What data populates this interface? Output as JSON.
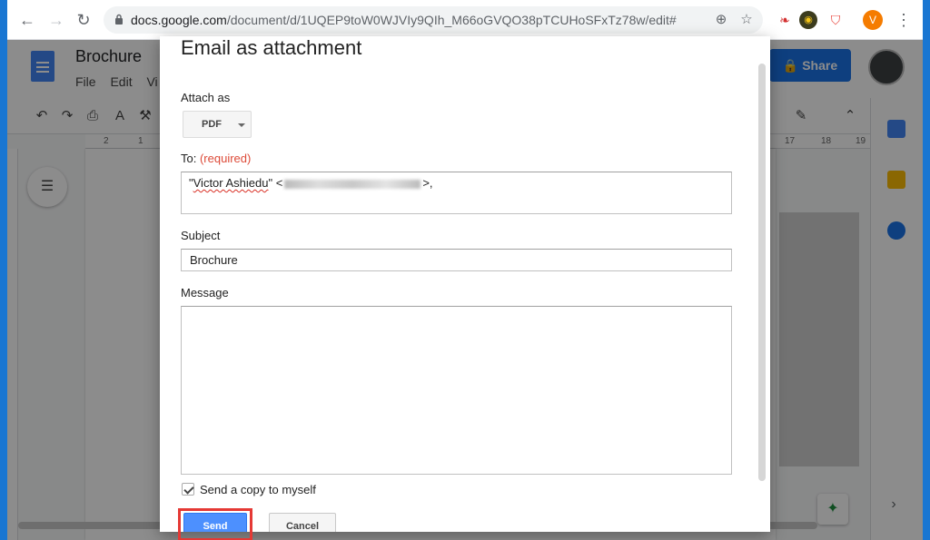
{
  "browser": {
    "url_host": "docs.google.com",
    "url_path": "/document/d/1UQEP9toW0WJVIy9QIh_M66oGVQO38pTCUHoSFxTz78w/edit#",
    "profile_initial": "V"
  },
  "docs": {
    "title": "Brochure",
    "menu": [
      "File",
      "Edit",
      "Vi"
    ],
    "share_label": "Share",
    "ruler_numbers": [
      "2",
      "1",
      "17",
      "18",
      "19"
    ]
  },
  "dialog": {
    "title": "Email as attachment",
    "attach_as_label": "Attach as",
    "attach_format": "PDF",
    "to_label": "To:",
    "to_required": "(required)",
    "to_value_quote_open": "\"",
    "to_value_name": "Victor Ashiedu",
    "to_value_rest": "\" <",
    "to_value_end": ">,",
    "subject_label": "Subject",
    "subject_value": "Brochure",
    "message_label": "Message",
    "message_value": "",
    "copy_label": "Send a copy to myself",
    "copy_checked": true,
    "send_label": "Send",
    "cancel_label": "Cancel"
  },
  "colors": {
    "accent": "#4d90fe",
    "highlight": "#e53935",
    "required": "#dd4b39"
  }
}
